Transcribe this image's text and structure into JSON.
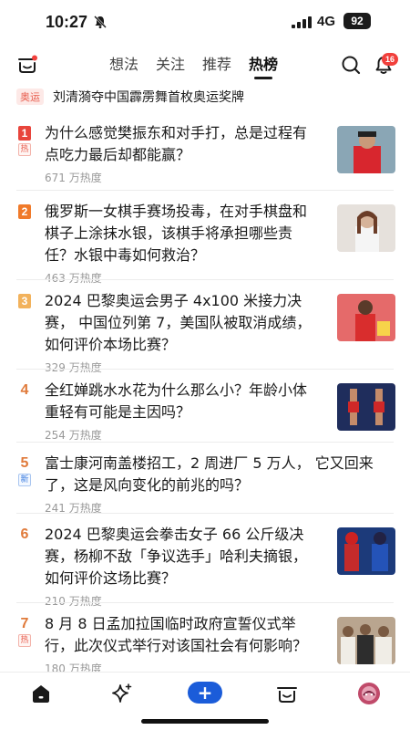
{
  "status_bar": {
    "time": "10:27",
    "network": "4G",
    "battery": "92"
  },
  "top_nav": {
    "tabs": [
      {
        "label": "想法"
      },
      {
        "label": "关注"
      },
      {
        "label": "推荐"
      },
      {
        "label": "热榜",
        "active": true
      }
    ],
    "notification_count": "16"
  },
  "banner": {
    "tag": "奥运",
    "text": "刘清漪夺中国霹雳舞首枚奥运奖牌"
  },
  "hot_list": [
    {
      "rank": "1",
      "tag": "热",
      "tag_type": "hot",
      "title_lines": [
        "为什么感觉樊振东和对手打，总是过程有",
        "点吃力最后却都能赢？"
      ],
      "heat": "671 万热度",
      "thumb": true,
      "rank_color": "#e8453c"
    },
    {
      "rank": "2",
      "tag": "",
      "tag_type": "",
      "title_lines": [
        "俄罗斯一女棋手赛场投毒，在对手棋盘和",
        "棋子上涂抹水银，该棋手将承担哪些责",
        "任？水银中毒如何救治？"
      ],
      "heat": "463 万热度",
      "thumb": true,
      "rank_color": "#f07a2a"
    },
    {
      "rank": "3",
      "tag": "",
      "tag_type": "",
      "title_lines": [
        "2024 巴黎奥运会男子 4x100 米接力决",
        "赛， 中国位列第 7，美国队被取消成绩，",
        "如何评价本场比赛？"
      ],
      "heat": "329 万热度",
      "thumb": true,
      "rank_color": "#f2b25c"
    },
    {
      "rank": "4",
      "tag": "",
      "tag_type": "",
      "title_lines": [
        "全红婵跳水水花为什么那么小？年龄小体",
        "重轻有可能是主因吗？"
      ],
      "heat": "254 万热度",
      "thumb": true,
      "rank_color": ""
    },
    {
      "rank": "5",
      "tag": "新",
      "tag_type": "new",
      "title_lines": [
        "富士康河南盖楼招工，2 周进厂 5 万人， 它又回来",
        "了，这是风向变化的前兆的吗？"
      ],
      "heat": "241 万热度",
      "thumb": false,
      "rank_color": ""
    },
    {
      "rank": "6",
      "tag": "",
      "tag_type": "",
      "title_lines": [
        "2024 巴黎奥运会拳击女子 66 公斤级决",
        "赛，杨柳不敌「争议选手」哈利夫摘银，",
        "如何评价这场比赛？"
      ],
      "heat": "210 万热度",
      "thumb": true,
      "rank_color": ""
    },
    {
      "rank": "7",
      "tag": "热",
      "tag_type": "hot",
      "title_lines": [
        "8 月 8 日孟加拉国临时政府宣誓仪式举",
        "行，此次仪式举行对该国社会有何影响？"
      ],
      "heat": "180 万热度",
      "thumb": true,
      "rank_color": ""
    }
  ],
  "bottom_nav": {
    "items": [
      {
        "icon": "home-icon"
      },
      {
        "icon": "sparkle-icon"
      },
      {
        "icon": "add-icon",
        "label": "+"
      },
      {
        "icon": "cart-icon"
      },
      {
        "icon": "avatar"
      }
    ]
  }
}
